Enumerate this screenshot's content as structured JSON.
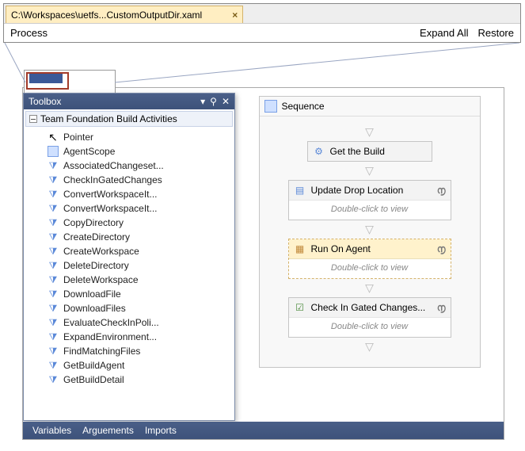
{
  "tab": {
    "path": "C:\\Workspaces\\uetfs...CustomOutputDir.xaml",
    "close": "×"
  },
  "bar": {
    "left": "Process",
    "expand": "Expand All",
    "restore": "Restore"
  },
  "toolbox": {
    "title": "Toolbox",
    "dropdown_glyph": "▾",
    "pin_glyph": "⚲",
    "close_glyph": "✕",
    "group": "Team Foundation Build Activities",
    "items": [
      {
        "k": "pointer",
        "label": "Pointer"
      },
      {
        "k": "scope",
        "label": "AgentScope"
      },
      {
        "k": "act",
        "label": "AssociatedChangeset..."
      },
      {
        "k": "act",
        "label": "CheckInGatedChanges"
      },
      {
        "k": "act",
        "label": "ConvertWorkspaceIt..."
      },
      {
        "k": "act",
        "label": "ConvertWorkspaceIt..."
      },
      {
        "k": "act",
        "label": "CopyDirectory"
      },
      {
        "k": "act",
        "label": "CreateDirectory"
      },
      {
        "k": "act",
        "label": "CreateWorkspace"
      },
      {
        "k": "act",
        "label": "DeleteDirectory"
      },
      {
        "k": "act",
        "label": "DeleteWorkspace"
      },
      {
        "k": "act",
        "label": "DownloadFile"
      },
      {
        "k": "act",
        "label": "DownloadFiles"
      },
      {
        "k": "act",
        "label": "EvaluateCheckInPoli..."
      },
      {
        "k": "act",
        "label": "ExpandEnvironment..."
      },
      {
        "k": "act",
        "label": "FindMatchingFiles"
      },
      {
        "k": "act",
        "label": "GetBuildAgent"
      },
      {
        "k": "act",
        "label": "GetBuildDetail"
      }
    ]
  },
  "designer": {
    "sequence_label": "Sequence",
    "arrow_glyph": "▽",
    "chevron_glyph": "൱",
    "hint": "Double-click to view",
    "nodes": {
      "get_build": "Get the Build",
      "update_drop": "Update Drop Location",
      "run_agent": "Run On Agent",
      "check_in": "Check In Gated Changes..."
    }
  },
  "bottom": {
    "variables": "Variables",
    "arguments": "Arguements",
    "imports": "Imports"
  }
}
